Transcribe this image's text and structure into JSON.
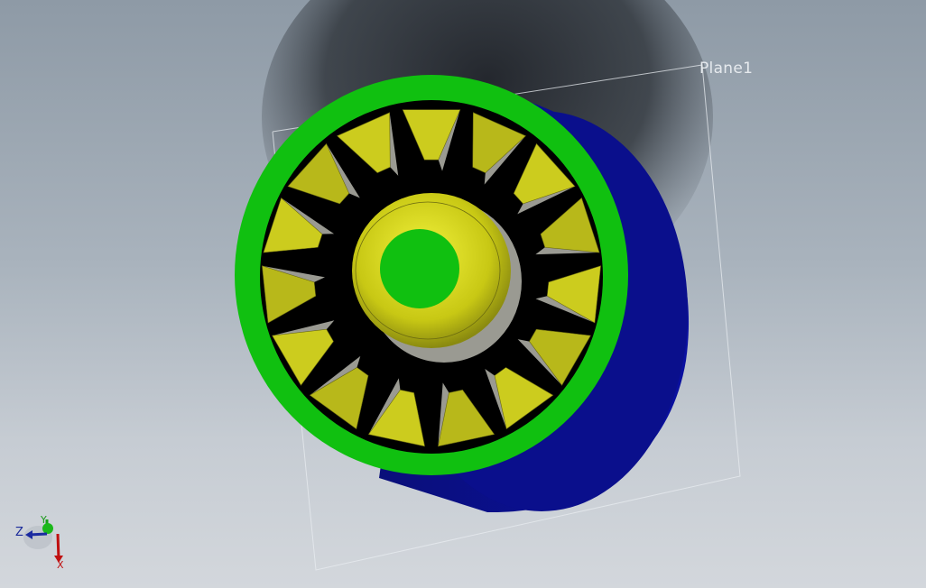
{
  "viewport": {
    "background_top": "#8e9aa6",
    "background_bottom": "#d3d7dc"
  },
  "model": {
    "colors": {
      "housing": "#0a0f8c",
      "ring": "#10c010",
      "blade": "#c8c81e",
      "hub": "#d4d418",
      "bore": "#10c010",
      "cavity": "#000000"
    },
    "blade_count": 15
  },
  "plane": {
    "label": "Plane1"
  },
  "triad": {
    "z_label": "Z",
    "y_label": "Y",
    "x_label": "X",
    "icon": "coordinate-triad-icon"
  }
}
